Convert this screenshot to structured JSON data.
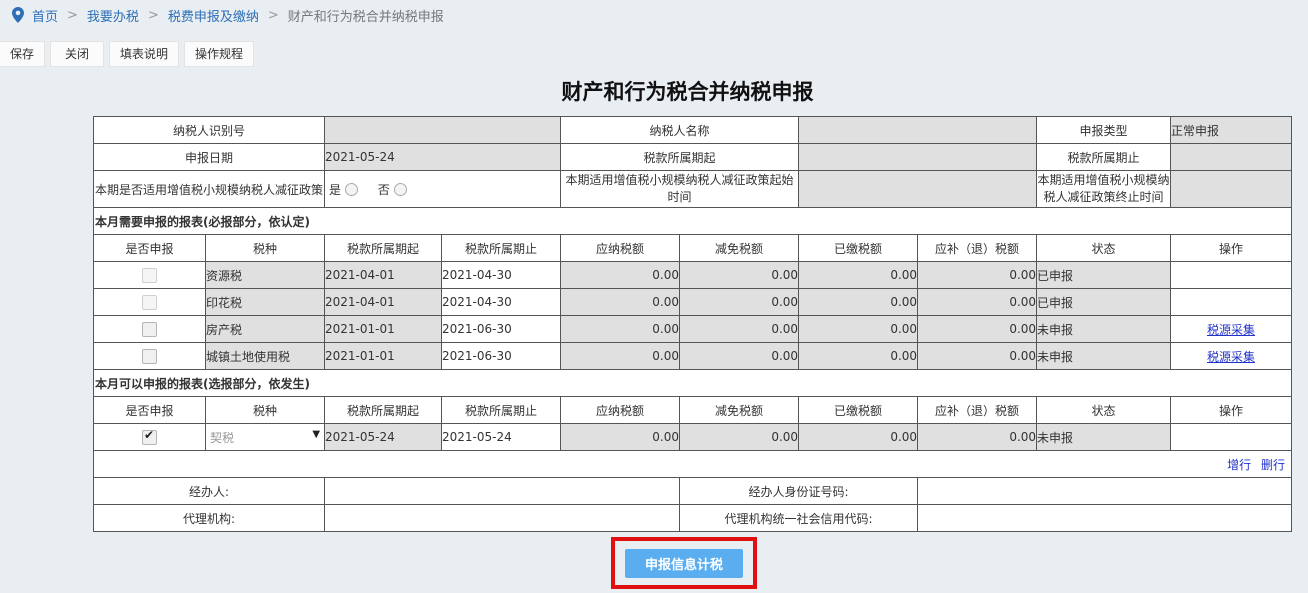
{
  "breadcrumb": {
    "items": [
      "首页",
      "我要办税",
      "税费申报及缴纳"
    ],
    "separator": ">",
    "current": "财产和行为税合并纳税申报"
  },
  "toolbar": {
    "save": "保存",
    "close": "关闭",
    "fill_help": "填表说明",
    "operation_rules": "操作规程"
  },
  "title": "财产和行为税合并纳税申报",
  "info": {
    "taxpayer_id_label": "纳税人识别号",
    "taxpayer_id_value": "",
    "taxpayer_name_label": "纳税人名称",
    "taxpayer_name_value": "",
    "declare_type_label": "申报类型",
    "declare_type_value": "正常申报",
    "declare_date_label": "申报日期",
    "declare_date_value": "2021-05-24",
    "period_start_label": "税款所属期起",
    "period_start_value": "",
    "period_end_label": "税款所属期止",
    "period_end_value": "",
    "small_scale_label": "本期是否适用增值税小规模纳税人减征政策",
    "yes_label": "是",
    "no_label": "否",
    "small_scale_start_label": "本期适用增值税小规模纳税人减征政策起始时间",
    "small_scale_start_value": "",
    "small_scale_end_label": "本期适用增值税小规模纳税人减征政策终止时间",
    "small_scale_end_value": ""
  },
  "columns": [
    "是否申报",
    "税种",
    "税款所属期起",
    "税款所属期止",
    "应纳税额",
    "减免税额",
    "已缴税额",
    "应补（退）税额",
    "状态",
    "操作"
  ],
  "section_required": {
    "title": "本月需要申报的报表(必报部分，依认定)",
    "rows": [
      {
        "tax": "资源税",
        "start": "2021-04-01",
        "end": "2021-04-30",
        "payable": "0.00",
        "relief": "0.00",
        "paid": "0.00",
        "due": "0.00",
        "status": "已申报",
        "action": ""
      },
      {
        "tax": "印花税",
        "start": "2021-04-01",
        "end": "2021-04-30",
        "payable": "0.00",
        "relief": "0.00",
        "paid": "0.00",
        "due": "0.00",
        "status": "已申报",
        "action": ""
      },
      {
        "tax": "房产税",
        "start": "2021-01-01",
        "end": "2021-06-30",
        "payable": "0.00",
        "relief": "0.00",
        "paid": "0.00",
        "due": "0.00",
        "status": "未申报",
        "action": "税源采集"
      },
      {
        "tax": "城镇土地使用税",
        "start": "2021-01-01",
        "end": "2021-06-30",
        "payable": "0.00",
        "relief": "0.00",
        "paid": "0.00",
        "due": "0.00",
        "status": "未申报",
        "action": "税源采集"
      }
    ]
  },
  "section_optional": {
    "title": "本月可以申报的报表(选报部分，依发生)",
    "row": {
      "tax": "契税",
      "start": "2021-05-24",
      "end": "2021-05-24",
      "payable": "0.00",
      "relief": "0.00",
      "paid": "0.00",
      "due": "0.00",
      "status": "未申报"
    },
    "add_row": "增行",
    "delete_row": "删行"
  },
  "agent": {
    "handler_label": "经办人:",
    "handler_id_label": "经办人身份证号码:",
    "agency_label": "代理机构:",
    "agency_code_label": "代理机构统一社会信用代码:"
  },
  "submit_label": "申报信息计税",
  "colors": {
    "accent": "#5aaef0",
    "highlight_border": "#e01010",
    "link": "#2233cc"
  }
}
